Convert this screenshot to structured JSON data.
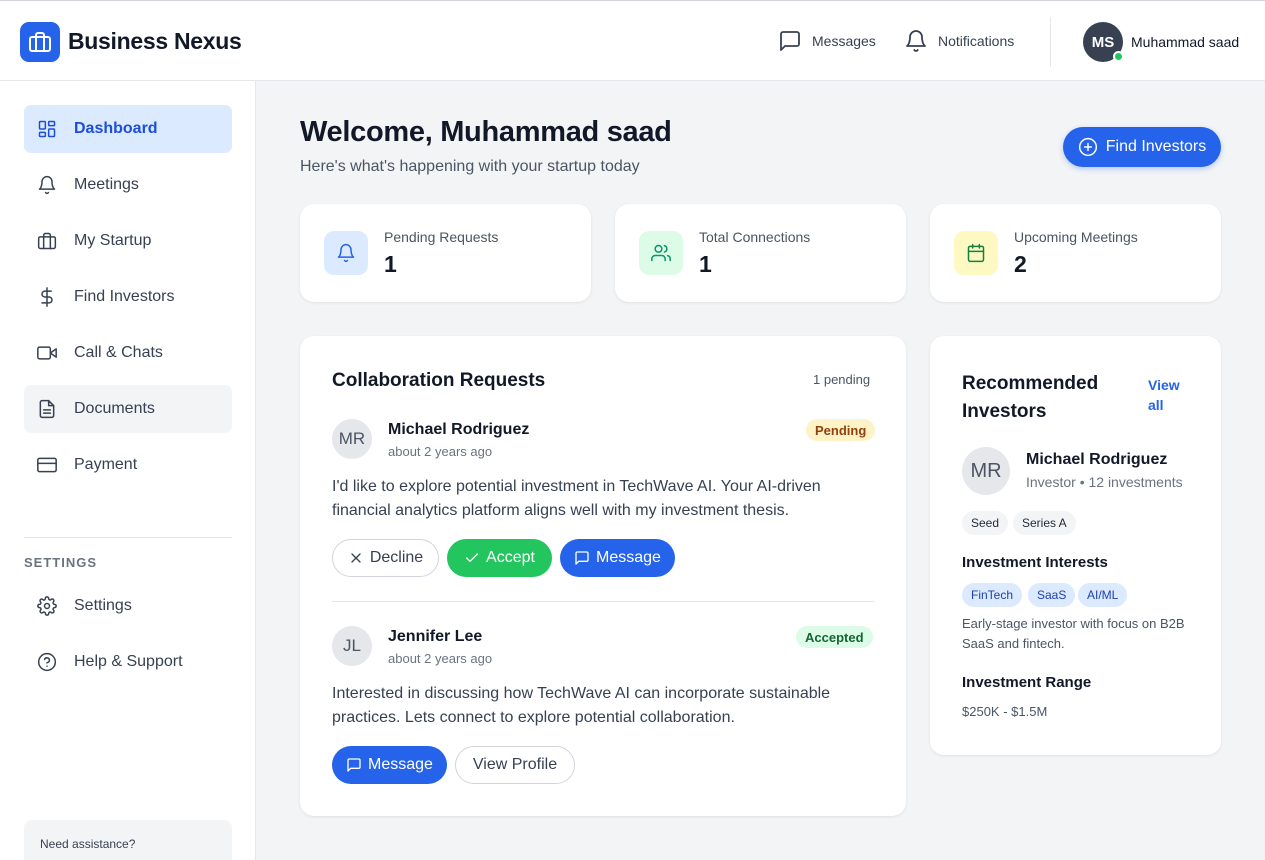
{
  "app": {
    "brand": "Business Nexus"
  },
  "header": {
    "messages_label": "Messages",
    "notifications_label": "Notifications",
    "user_initials": "MS",
    "user_name": "Muhammad saad"
  },
  "sidebar": {
    "items": [
      {
        "label": "Dashboard",
        "icon": "dashboard-icon"
      },
      {
        "label": "Meetings",
        "icon": "bell-icon"
      },
      {
        "label": "My Startup",
        "icon": "briefcase-icon"
      },
      {
        "label": "Find Investors",
        "icon": "dollar-icon"
      },
      {
        "label": "Call & Chats",
        "icon": "video-icon"
      },
      {
        "label": "Documents",
        "icon": "document-icon"
      },
      {
        "label": "Payment",
        "icon": "credit-card-icon"
      }
    ],
    "settings_heading": "SETTINGS",
    "settings_items": [
      {
        "label": "Settings",
        "icon": "gear-icon"
      },
      {
        "label": "Help & Support",
        "icon": "help-icon"
      }
    ],
    "assistance_text": "Need assistance?"
  },
  "main": {
    "welcome": "Welcome, Muhammad saad",
    "subtitle": "Here's what's happening with your startup today",
    "find_investors_button": "Find Investors",
    "stats": [
      {
        "label": "Pending Requests",
        "value": "1",
        "icon": "bell-icon",
        "color": "#2563eb",
        "bg": "#dbeafe"
      },
      {
        "label": "Total Connections",
        "value": "1",
        "icon": "users-icon",
        "color": "#059669",
        "bg": "#dcfce7"
      },
      {
        "label": "Upcoming Meetings",
        "value": "2",
        "icon": "calendar-icon",
        "color": "#15803d",
        "bg": "#fef9c3"
      }
    ]
  },
  "collaboration": {
    "title": "Collaboration Requests",
    "pending_count": "1 pending",
    "requests": [
      {
        "initials": "MR",
        "name": "Michael Rodriguez",
        "time": "about 2 years ago",
        "status": "Pending",
        "message": "I'd like to explore potential investment in TechWave AI. Your AI-driven financial analytics platform aligns well with my investment thesis.",
        "decline_label": "Decline",
        "accept_label": "Accept",
        "message_label": "Message"
      },
      {
        "initials": "JL",
        "name": "Jennifer Lee",
        "time": "about 2 years ago",
        "status": "Accepted",
        "message": "Interested in discussing how TechWave AI can incorporate sustainable practices. Lets connect to explore potential collaboration.",
        "message_label": "Message",
        "view_profile_label": "View Profile"
      }
    ]
  },
  "recommended": {
    "title_line1": "Recommended",
    "title_line2": "Investors",
    "view_all_line1": "View",
    "view_all_line2": "all",
    "investor": {
      "initials": "MR",
      "name": "Michael Rodriguez",
      "role": "Investor • 12 investments",
      "stages": [
        "Seed",
        "Series A"
      ],
      "interests_heading": "Investment Interests",
      "interests": [
        "FinTech",
        "SaaS",
        "AI/ML"
      ],
      "bio": "Early-stage investor with focus on B2B SaaS and fintech.",
      "range_heading": "Investment Range",
      "range": "$250K - $1.5M"
    }
  },
  "colors": {
    "accent": "#2563eb",
    "success": "#22c55e",
    "pending_badge_bg": "#fef3c7",
    "pending_badge_text": "#92400e",
    "accepted_badge_bg": "#dcfce7",
    "accepted_badge_text": "#166534"
  }
}
